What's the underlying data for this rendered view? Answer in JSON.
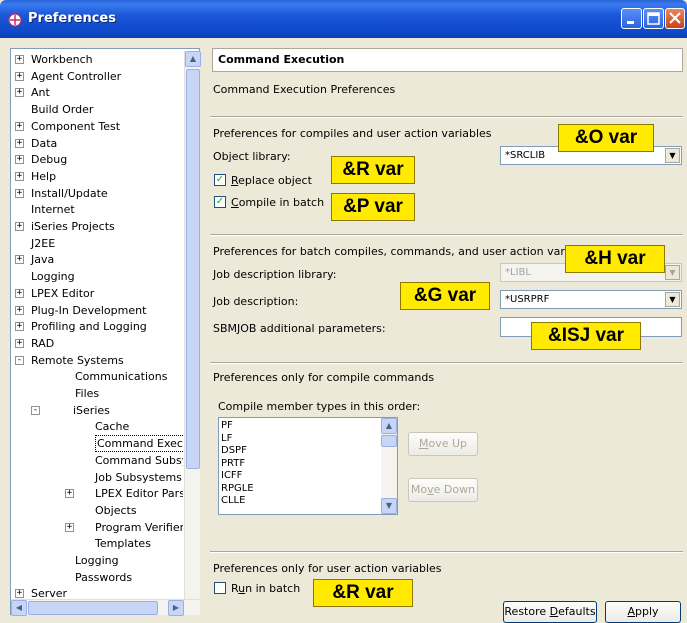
{
  "window": {
    "title": "Preferences",
    "buttons": [
      "minimize",
      "maximize",
      "close"
    ]
  },
  "tree": {
    "items": [
      {
        "label": "Workbench",
        "expander": "+",
        "indent": 0
      },
      {
        "label": "Agent Controller",
        "expander": "+",
        "indent": 0
      },
      {
        "label": "Ant",
        "expander": "+",
        "indent": 0
      },
      {
        "label": "Build Order",
        "expander": "",
        "indent": 0
      },
      {
        "label": "Component Test",
        "expander": "+",
        "indent": 0
      },
      {
        "label": "Data",
        "expander": "+",
        "indent": 0
      },
      {
        "label": "Debug",
        "expander": "+",
        "indent": 0
      },
      {
        "label": "Help",
        "expander": "+",
        "indent": 0
      },
      {
        "label": "Install/Update",
        "expander": "+",
        "indent": 0
      },
      {
        "label": "Internet",
        "expander": "",
        "indent": 0
      },
      {
        "label": "iSeries Projects",
        "expander": "+",
        "indent": 0
      },
      {
        "label": "J2EE",
        "expander": "",
        "indent": 0
      },
      {
        "label": "Java",
        "expander": "+",
        "indent": 0
      },
      {
        "label": "Logging",
        "expander": "",
        "indent": 0
      },
      {
        "label": "LPEX Editor",
        "expander": "+",
        "indent": 0
      },
      {
        "label": "Plug-In Development",
        "expander": "+",
        "indent": 0
      },
      {
        "label": "Profiling and Logging",
        "expander": "+",
        "indent": 0
      },
      {
        "label": "RAD",
        "expander": "+",
        "indent": 0
      },
      {
        "label": "Remote Systems",
        "expander": "−",
        "indent": 0
      },
      {
        "label": "Communications",
        "expander": "",
        "indent": 1
      },
      {
        "label": "Files",
        "expander": "",
        "indent": 1
      },
      {
        "label": "iSeries",
        "expander": "−",
        "indent": 1
      },
      {
        "label": "Cache",
        "expander": "",
        "indent": 2
      },
      {
        "label": "Command Execution",
        "expander": "",
        "indent": 2,
        "selected": true
      },
      {
        "label": "Command Subsyste",
        "expander": "",
        "indent": 2
      },
      {
        "label": "Job Subsystems",
        "expander": "",
        "indent": 2
      },
      {
        "label": "LPEX Editor Parsers",
        "expander": "+",
        "indent": 2
      },
      {
        "label": "Objects",
        "expander": "",
        "indent": 2
      },
      {
        "label": "Program Verifiers",
        "expander": "+",
        "indent": 2
      },
      {
        "label": "Templates",
        "expander": "",
        "indent": 2
      },
      {
        "label": "Logging",
        "expander": "",
        "indent": 1
      },
      {
        "label": "Passwords",
        "expander": "",
        "indent": 1
      },
      {
        "label": "Server",
        "expander": "+",
        "indent": 0
      }
    ]
  },
  "page": {
    "title": "Command Execution",
    "description": "Command Execution Preferences",
    "compile_section": {
      "heading": "Preferences for compiles and user action variables",
      "object_library_label": "Object library:",
      "object_library_value": "*SRCLIB",
      "replace_object": {
        "mnemonic": "R",
        "rest": "eplace object",
        "checked": true
      },
      "compile_in_batch": {
        "mnemonic": "C",
        "rest": "ompile in batch",
        "checked": true
      }
    },
    "batch_section": {
      "heading": "Preferences for batch compiles, commands, and user action variables",
      "job_desc_library_label": "Job description library:",
      "job_desc_library_value": "*LIBL",
      "job_desc_label": "Job description:",
      "job_desc_value": "*USRPRF",
      "sbmjob_label": "SBMJOB additional parameters:",
      "sbmjob_value": ""
    },
    "compile_only_section": {
      "heading": "Preferences only for compile commands",
      "list_label": "Compile member types in this order:",
      "member_types": [
        "PF",
        "LF",
        "DSPF",
        "PRTF",
        "ICFF",
        "RPGLE",
        "CLLE"
      ],
      "move_up": {
        "mnemonic": "M",
        "rest": "ove Up"
      },
      "move_down": {
        "before": "Mo",
        "mnemonic": "v",
        "rest": "e Down"
      }
    },
    "user_action_section": {
      "heading": "Preferences only for user action variables",
      "run_in_batch": {
        "before": "R",
        "mnemonic": "u",
        "rest": "n in batch",
        "checked": false
      }
    },
    "restore_defaults": {
      "before": "Restore ",
      "mnemonic": "D",
      "rest": "efaults"
    },
    "apply": {
      "mnemonic": "A",
      "rest": "pply"
    }
  },
  "annotations": {
    "o_var": "&O var",
    "r_var_1": "&R var",
    "p_var": "&P var",
    "h_var": "&H var",
    "g_var": "&G var",
    "isj_var": "&ISJ var",
    "r_var_2": "&R var"
  },
  "colors": {
    "titlebar": "#0f49c9",
    "annotation": "#ffea00",
    "panel": "#ece9d8",
    "check": "#21a121"
  }
}
